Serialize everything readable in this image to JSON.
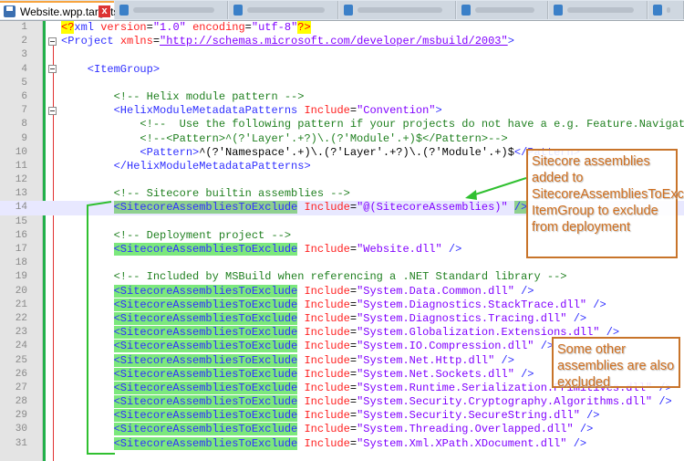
{
  "tabs": {
    "active": "Website.wpp.targets",
    "close": "x"
  },
  "lines": [
    [
      [
        "pi",
        "<?"
      ],
      [
        "tag",
        "xml "
      ],
      [
        "attr",
        "version"
      ],
      [
        "text",
        "="
      ],
      [
        "val",
        "\"1.0\" "
      ],
      [
        "attr",
        "encoding"
      ],
      [
        "text",
        "="
      ],
      [
        "val",
        "\"utf-8\""
      ],
      [
        "pi",
        "?>"
      ]
    ],
    [
      [
        "tag",
        "<Project "
      ],
      [
        "attr",
        "xmlns"
      ],
      [
        "text",
        "="
      ],
      [
        "url",
        "\"http://schemas.microsoft.com/developer/msbuild/2003\""
      ],
      [
        "tag",
        ">"
      ]
    ],
    [],
    [
      [
        "tag",
        "    <ItemGroup>"
      ]
    ],
    [],
    [
      [
        "comment",
        "        <!-- Helix module pattern -->"
      ]
    ],
    [
      [
        "tag",
        "        <HelixModuleMetadataPatterns "
      ],
      [
        "attr",
        "Include"
      ],
      [
        "text",
        "="
      ],
      [
        "val",
        "\"Convention\""
      ],
      [
        "tag",
        ">"
      ]
    ],
    [
      [
        "comment",
        "            <!--  Use the following pattern if your projects do not have a e.g. Feature.Navigati"
      ]
    ],
    [
      [
        "comment",
        "            <!--<Pattern>^(?'Layer'.+?)\\.(?'Module'.+)$</Pattern>-->"
      ]
    ],
    [
      [
        "tag",
        "            <Pattern>"
      ],
      [
        "text",
        "^(?'Namespace'.+)\\.(?'Layer'.+?)\\.(?'Module'.+)$"
      ],
      [
        "tag",
        "</Pattern>"
      ]
    ],
    [
      [
        "tag",
        "        </HelixModuleMetadataPatterns>"
      ]
    ],
    [],
    [
      [
        "comment",
        "        <!-- Sitecore builtin assemblies -->"
      ]
    ],
    [
      [
        "text",
        "        "
      ],
      [
        "hl2",
        "<SitecoreAssembliesToExclude"
      ],
      [
        "attr",
        " Include"
      ],
      [
        "text",
        "="
      ],
      [
        "val",
        "\"@(SitecoreAssemblies)\" "
      ],
      [
        "hl2",
        "/>"
      ]
    ],
    [],
    [
      [
        "comment",
        "        <!-- Deployment project -->"
      ]
    ],
    [
      [
        "text",
        "        "
      ],
      [
        "hl",
        "<SitecoreAssembliesToExclude"
      ],
      [
        "attr",
        " Include"
      ],
      [
        "text",
        "="
      ],
      [
        "val",
        "\"Website.dll\""
      ],
      [
        "tag",
        " />"
      ]
    ],
    [],
    [
      [
        "comment",
        "        <!-- Included by MSBuild when referencing a .NET Standard library -->"
      ]
    ],
    [
      [
        "text",
        "        "
      ],
      [
        "hl",
        "<SitecoreAssembliesToExclude"
      ],
      [
        "attr",
        " Include"
      ],
      [
        "text",
        "="
      ],
      [
        "val",
        "\"System.Data.Common.dll\""
      ],
      [
        "tag",
        " />"
      ]
    ],
    [
      [
        "text",
        "        "
      ],
      [
        "hl",
        "<SitecoreAssembliesToExclude"
      ],
      [
        "attr",
        " Include"
      ],
      [
        "text",
        "="
      ],
      [
        "val",
        "\"System.Diagnostics.StackTrace.dll\""
      ],
      [
        "tag",
        " />"
      ]
    ],
    [
      [
        "text",
        "        "
      ],
      [
        "hl",
        "<SitecoreAssembliesToExclude"
      ],
      [
        "attr",
        " Include"
      ],
      [
        "text",
        "="
      ],
      [
        "val",
        "\"System.Diagnostics.Tracing.dll\""
      ],
      [
        "tag",
        " />"
      ]
    ],
    [
      [
        "text",
        "        "
      ],
      [
        "hl",
        "<SitecoreAssembliesToExclude"
      ],
      [
        "attr",
        " Include"
      ],
      [
        "text",
        "="
      ],
      [
        "val",
        "\"System.Globalization.Extensions.dll\""
      ],
      [
        "tag",
        " />"
      ]
    ],
    [
      [
        "text",
        "        "
      ],
      [
        "hl",
        "<SitecoreAssembliesToExclude"
      ],
      [
        "attr",
        " Include"
      ],
      [
        "text",
        "="
      ],
      [
        "val",
        "\"System.IO.Compression.dll\""
      ],
      [
        "tag",
        " />"
      ]
    ],
    [
      [
        "text",
        "        "
      ],
      [
        "hl",
        "<SitecoreAssembliesToExclude"
      ],
      [
        "attr",
        " Include"
      ],
      [
        "text",
        "="
      ],
      [
        "val",
        "\"System.Net.Http.dll\""
      ],
      [
        "tag",
        " />"
      ]
    ],
    [
      [
        "text",
        "        "
      ],
      [
        "hl",
        "<SitecoreAssembliesToExclude"
      ],
      [
        "attr",
        " Include"
      ],
      [
        "text",
        "="
      ],
      [
        "val",
        "\"System.Net.Sockets.dll\""
      ],
      [
        "tag",
        " />"
      ]
    ],
    [
      [
        "text",
        "        "
      ],
      [
        "hl",
        "<SitecoreAssembliesToExclude"
      ],
      [
        "attr",
        " Include"
      ],
      [
        "text",
        "="
      ],
      [
        "val",
        "\"System.Runtime.Serialization.Primitives.dll\""
      ],
      [
        "tag",
        " />"
      ]
    ],
    [
      [
        "text",
        "        "
      ],
      [
        "hl",
        "<SitecoreAssembliesToExclude"
      ],
      [
        "attr",
        " Include"
      ],
      [
        "text",
        "="
      ],
      [
        "val",
        "\"System.Security.Cryptography.Algorithms.dll\""
      ],
      [
        "tag",
        " />"
      ]
    ],
    [
      [
        "text",
        "        "
      ],
      [
        "hl",
        "<SitecoreAssembliesToExclude"
      ],
      [
        "attr",
        " Include"
      ],
      [
        "text",
        "="
      ],
      [
        "val",
        "\"System.Security.SecureString.dll\""
      ],
      [
        "tag",
        " />"
      ]
    ],
    [
      [
        "text",
        "        "
      ],
      [
        "hl",
        "<SitecoreAssembliesToExclude"
      ],
      [
        "attr",
        " Include"
      ],
      [
        "text",
        "="
      ],
      [
        "val",
        "\"System.Threading.Overlapped.dll\""
      ],
      [
        "tag",
        " />"
      ]
    ],
    [
      [
        "text",
        "        "
      ],
      [
        "hl",
        "<SitecoreAssembliesToExclude"
      ],
      [
        "attr",
        " Include"
      ],
      [
        "text",
        "="
      ],
      [
        "val",
        "\"System.Xml.XPath.XDocument.dll\""
      ],
      [
        "tag",
        " />"
      ]
    ]
  ],
  "current_line": 14,
  "callouts": {
    "first": "Sitecore assemblies added to SitecoreAssembliesToExclude ItemGroup to exclude from deployment",
    "second": "Some other assemblies are also excluded"
  }
}
